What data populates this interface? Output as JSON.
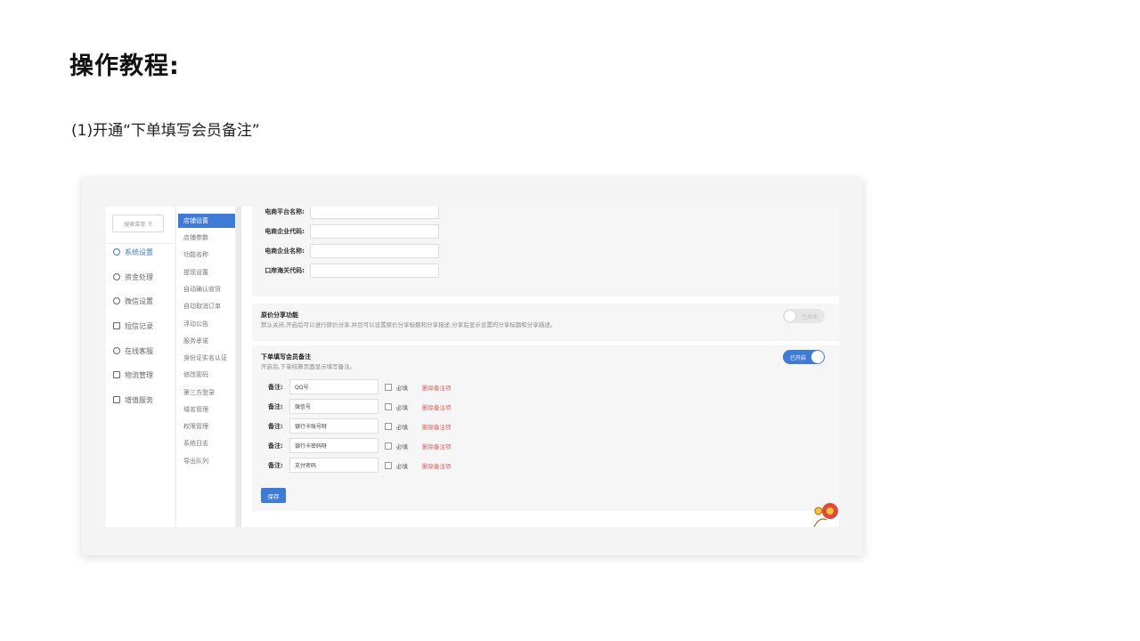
{
  "doc": {
    "title": "操作教程:",
    "step": "(1)开通“下单填写会员备注”"
  },
  "nav_primary": {
    "search_placeholder": "搜索菜单",
    "items": [
      {
        "label": "系统设置",
        "icon": "gear-icon",
        "active": true
      },
      {
        "label": "资金处理",
        "icon": "money-icon"
      },
      {
        "label": "微信设置",
        "icon": "wechat-icon"
      },
      {
        "label": "短信记录",
        "icon": "mail-icon"
      },
      {
        "label": "在线客服",
        "icon": "headset-icon"
      },
      {
        "label": "物流管理",
        "icon": "truck-icon"
      },
      {
        "label": "增值服务",
        "icon": "chart-icon"
      }
    ]
  },
  "nav_secondary": {
    "items": [
      {
        "label": "店铺设置",
        "active": true
      },
      {
        "label": "店铺参数"
      },
      {
        "label": "功能名称"
      },
      {
        "label": "提现设置"
      },
      {
        "label": "自动确认收货"
      },
      {
        "label": "自动取消订单"
      },
      {
        "label": "浮动公告"
      },
      {
        "label": "服务承诺"
      },
      {
        "label": "身份证实名认证"
      },
      {
        "label": "修改密码"
      },
      {
        "label": "第三方登录"
      },
      {
        "label": "域名管理"
      },
      {
        "label": "权限管理"
      },
      {
        "label": "系统日志"
      },
      {
        "label": "导出队列"
      }
    ]
  },
  "ecommerce_form": {
    "fields": [
      {
        "label": "电商平台名称:",
        "value": ""
      },
      {
        "label": "电商企业代码:",
        "value": ""
      },
      {
        "label": "电商企业名称:",
        "value": ""
      },
      {
        "label": "口岸海关代码:",
        "value": ""
      }
    ]
  },
  "share_section": {
    "title": "原价分享功能",
    "desc": "默认关闭,开启后可以进行原价分享,并且可以设置原价分享标题和分享描述,分享后显示设置的分享标题和分享描述。",
    "toggle_label": "已关闭",
    "enabled": false
  },
  "remark_section": {
    "title": "下单填写会员备注",
    "desc": "开启后,下单结算页面显示填写备注。",
    "toggle_label": "已开启",
    "enabled": true,
    "row_label": "备注:",
    "required_label": "必填",
    "delete_label": "删除备注项",
    "remarks": [
      "QQ号",
      "微信号",
      "银行卡账号呀",
      "银行卡密码呀",
      "支付密码"
    ],
    "save_label": "保存"
  },
  "colors": {
    "accent": "#3f7ad6",
    "danger": "#e55b5b"
  }
}
